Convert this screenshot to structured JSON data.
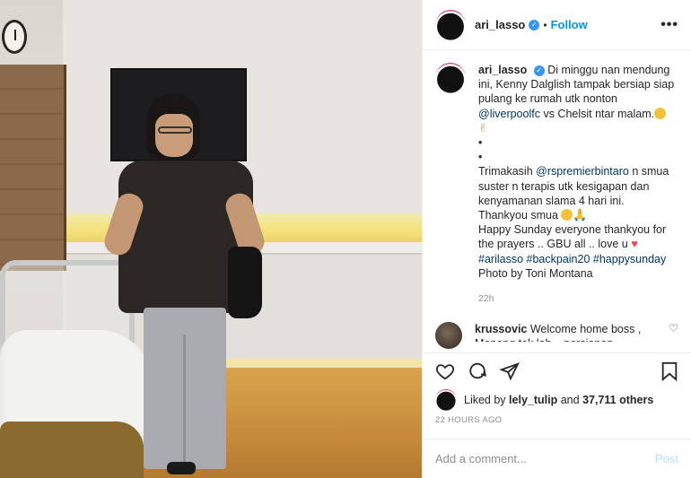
{
  "header": {
    "username": "ari_lasso",
    "separator": "•",
    "follow_label": "Follow",
    "more_icon": "ellipsis-icon"
  },
  "caption": {
    "username": "ari_lasso",
    "line1": "Di minggu nan mendung ini, Kenny Dalglish tampak bersiap siap pulang ke rumah utk nonton",
    "mention1": "@liverpoolfc",
    "line1b": "vs Chelsit ntar malam.",
    "bullet1": "•",
    "bullet2": "•",
    "thanks_pre": "Trimakasih",
    "mention2": "@rspremierbintaro",
    "thanks_post": "n smua suster n terapis utk kesigapan dan kenyamanan slama 4 hari ini.",
    "thanks2": "Thankyou smua",
    "happy": "Happy Sunday everyone thankyou for the prayers .. GBU all .. love u",
    "tag1": "#arilasso",
    "tag2": "#backpain20",
    "tag3": "#happysunday",
    "photo_by": "Photo by Toni Montana",
    "time": "22h"
  },
  "comment": {
    "username": "krussovic",
    "text": "Welcome home boss , Monang tok lah .. persiapan"
  },
  "likes": {
    "prefix": "Liked by",
    "user": "lely_tulip",
    "and": "and",
    "count": "37,711 others"
  },
  "posted": "22 HOURS AGO",
  "add_comment": {
    "placeholder": "Add a comment...",
    "post_label": "Post"
  },
  "colors": {
    "link": "#00376b",
    "follow": "#0095f6",
    "verified": "#3897f0",
    "post_disabled": "#b2dffc"
  }
}
